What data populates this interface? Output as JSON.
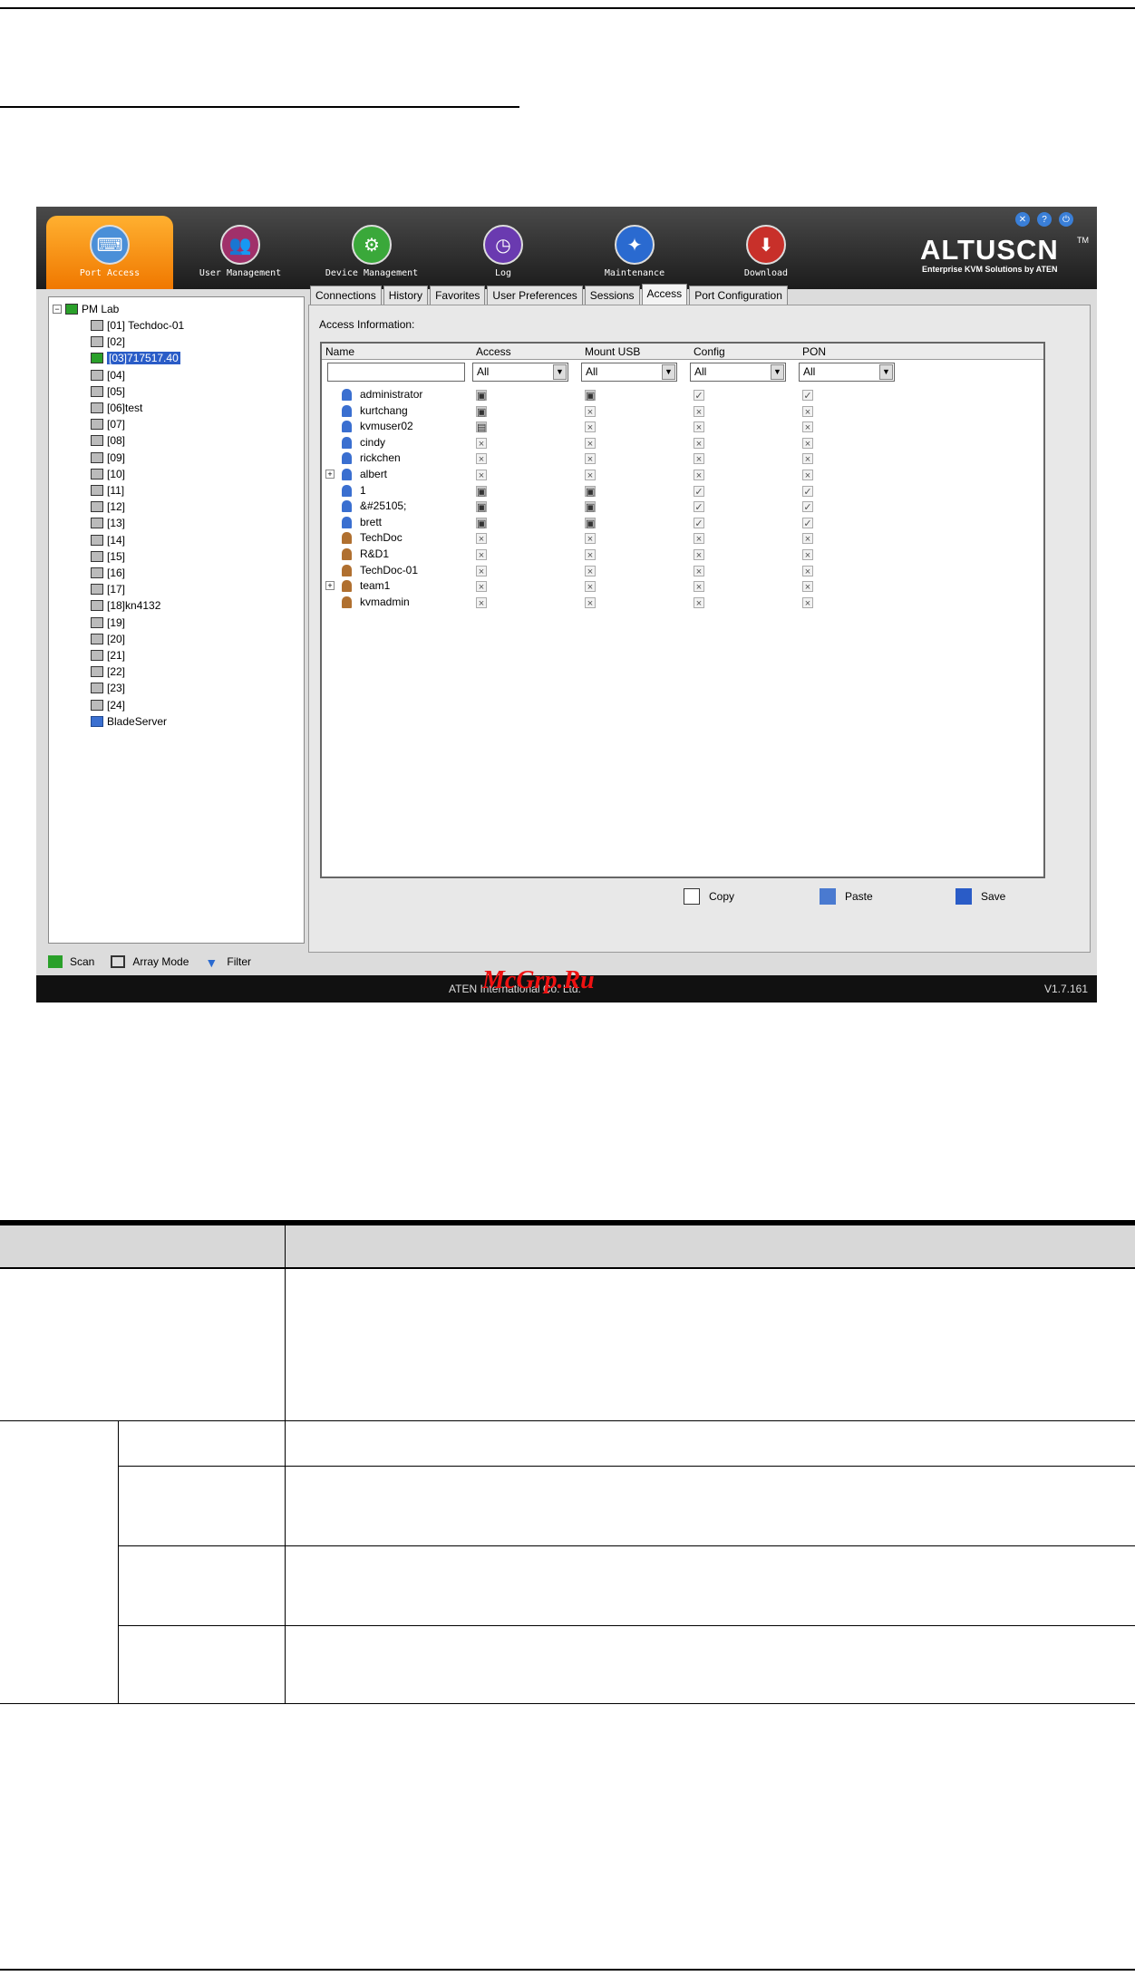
{
  "app": {
    "brand": "ALTUSCN",
    "brand_tm": "TM",
    "brand_subtitle": "Enterprise KVM Solutions by ATEN",
    "version": "V1.7.161",
    "status_text": "ATEN International Co. Ltd.",
    "watermark": "McGrp.Ru"
  },
  "nav": [
    {
      "label": "Port Access",
      "icon": "port-access-icon"
    },
    {
      "label": "User Management",
      "icon": "user-management-icon"
    },
    {
      "label": "Device Management",
      "icon": "device-management-icon"
    },
    {
      "label": "Log",
      "icon": "log-icon"
    },
    {
      "label": "Maintenance",
      "icon": "maintenance-icon"
    },
    {
      "label": "Download",
      "icon": "download-icon"
    }
  ],
  "tree": {
    "root": "PM Lab",
    "items": [
      "[01] Techdoc-01",
      "[02]",
      "[03]717517.40",
      "[04]",
      "[05]",
      "[06]test",
      "[07]",
      "[08]",
      "[09]",
      "[10]",
      "[11]",
      "[12]",
      "[13]",
      "[14]",
      "[15]",
      "[16]",
      "[17]",
      "[18]kn4132",
      "[19]",
      "[20]",
      "[21]",
      "[22]",
      "[23]",
      "[24]"
    ],
    "blade": "BladeServer"
  },
  "tools": {
    "scan": "Scan",
    "array_mode": "Array Mode",
    "filter": "Filter"
  },
  "tabs": [
    "Connections",
    "History",
    "Favorites",
    "User Preferences",
    "Sessions",
    "Access",
    "Port Configuration"
  ],
  "access": {
    "label": "Access Information:",
    "columns": [
      "Name",
      "Access",
      "Mount USB",
      "Config",
      "PON"
    ],
    "filter_value": "All",
    "users": [
      {
        "name": "administrator",
        "type": "user",
        "access": "full",
        "usb": "full",
        "config": "check",
        "pon": "check"
      },
      {
        "name": "kurtchang",
        "type": "user",
        "access": "full",
        "usb": "x",
        "config": "x",
        "pon": "x"
      },
      {
        "name": "kvmuser02",
        "type": "user",
        "access": "view",
        "usb": "x",
        "config": "x",
        "pon": "x"
      },
      {
        "name": "cindy",
        "type": "user",
        "access": "x",
        "usb": "x",
        "config": "x",
        "pon": "x"
      },
      {
        "name": "rickchen",
        "type": "user",
        "access": "x",
        "usb": "x",
        "config": "x",
        "pon": "x"
      },
      {
        "name": "albert",
        "type": "user",
        "expand": true,
        "access": "x",
        "usb": "x",
        "config": "x",
        "pon": "x"
      },
      {
        "name": "1",
        "type": "user",
        "access": "full",
        "usb": "full",
        "config": "check",
        "pon": "check"
      },
      {
        "name": "&#25105;",
        "type": "user",
        "access": "full",
        "usb": "full",
        "config": "check",
        "pon": "check"
      },
      {
        "name": "brett",
        "type": "user",
        "access": "full",
        "usb": "full",
        "config": "check",
        "pon": "check"
      },
      {
        "name": "TechDoc",
        "type": "group",
        "access": "x",
        "usb": "x",
        "config": "x",
        "pon": "x"
      },
      {
        "name": "R&D1",
        "type": "group",
        "access": "x",
        "usb": "x",
        "config": "x",
        "pon": "x"
      },
      {
        "name": "TechDoc-01",
        "type": "group",
        "access": "x",
        "usb": "x",
        "config": "x",
        "pon": "x"
      },
      {
        "name": "team1",
        "type": "group",
        "expand": true,
        "access": "x",
        "usb": "x",
        "config": "x",
        "pon": "x"
      },
      {
        "name": "kvmadmin",
        "type": "group",
        "access": "x",
        "usb": "x",
        "config": "x",
        "pon": "x"
      }
    ],
    "actions": {
      "copy": "Copy",
      "paste": "Paste",
      "save": "Save"
    }
  }
}
